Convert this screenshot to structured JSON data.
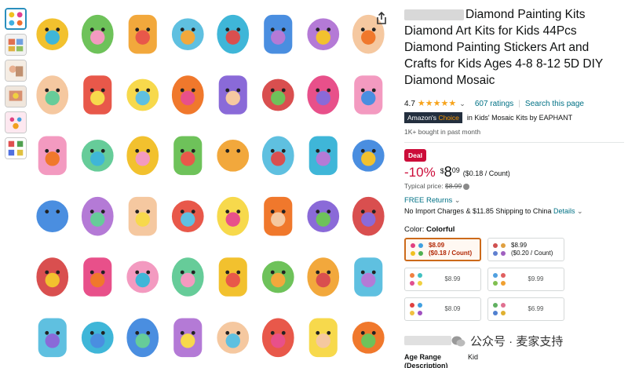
{
  "product": {
    "title": "Diamond Painting Kits Diamond Art Kits for Kids 44Pcs Diamond Painting Stickers Art and Crafts for Kids Ages 4-8 8-12 5D DIY Diamond Mosaic"
  },
  "rating": {
    "value": "4.7",
    "stars": 4.7,
    "ratings_count": "607 ratings",
    "search_link": "Search this page"
  },
  "badge": {
    "label_prefix": "Amazon's",
    "label_highlight": "Choice",
    "category": "in Kids' Mosaic Kits by EAPHANT"
  },
  "bought": "1K+ bought in past month",
  "deal": "Deal",
  "price": {
    "discount": "-10%",
    "currency": "$",
    "whole": "8",
    "fraction": "09",
    "per_unit": "($0.18 / Count)",
    "typical_label": "Typical price:",
    "typical_value": "$8.99"
  },
  "returns": "FREE Returns",
  "shipping": "No Import Charges & $11.85 Shipping to China",
  "shipping_link": "Details",
  "color": {
    "label": "Color:",
    "selected": "Colorful"
  },
  "options": [
    {
      "line1": "$8.09",
      "line2": "($0.18 / Count)",
      "selected": true
    },
    {
      "line1": "$8.99",
      "line2": "($0.20 / Count)",
      "selected": false
    },
    {
      "line1": "$8.99",
      "line2": "",
      "selected": false
    },
    {
      "line1": "$9.99",
      "line2": "",
      "selected": false
    },
    {
      "line1": "$8.09",
      "line2": "",
      "selected": false
    },
    {
      "line1": "$6.99",
      "line2": "",
      "selected": false
    }
  ],
  "age_label_1": "Age Range",
  "age_label_2": "(Description)",
  "age_value": "Kid",
  "watermark": "公众号 · 麦家支持",
  "colors": {
    "link": "#007185",
    "deal": "#cc0c39",
    "star": "#f7a31b",
    "choice_bg": "#232f3e",
    "selected_border": "#cc6a1a"
  }
}
